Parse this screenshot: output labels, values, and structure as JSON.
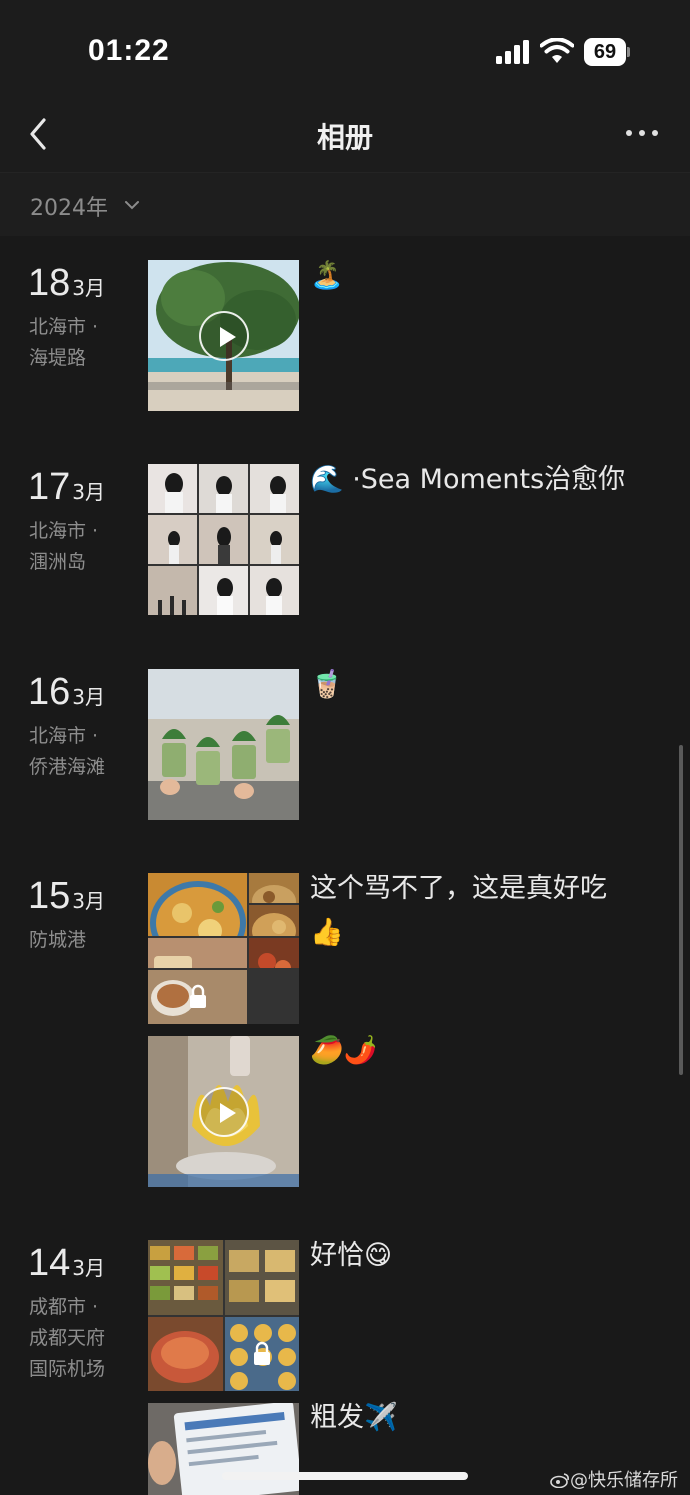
{
  "status_bar": {
    "time": "01:22",
    "battery": "69"
  },
  "nav": {
    "title": "相册"
  },
  "year_filter": {
    "label": "2024年"
  },
  "entries": [
    {
      "day": "18",
      "month": "3月",
      "location": [
        "北海市 ·",
        "海堤路"
      ],
      "caption": "🏝️"
    },
    {
      "day": "17",
      "month": "3月",
      "location": [
        "北海市 ·",
        "涠洲岛"
      ],
      "caption": "🌊 ·Sea Moments治愈你"
    },
    {
      "day": "16",
      "month": "3月",
      "location": [
        "北海市 ·",
        "侨港海滩"
      ],
      "caption": "🧋"
    },
    {
      "day": "15",
      "month": "3月",
      "location": [
        "防城港"
      ],
      "caption": "这个骂不了，这是真好吃👍",
      "caption2": "🥭🌶️"
    },
    {
      "day": "14",
      "month": "3月",
      "location": [
        "成都市 ·",
        "成都天府",
        "国际机场"
      ],
      "caption": "好恰😋",
      "caption2": "粗发✈️"
    }
  ],
  "watermark": "@快乐储存所",
  "colors": {
    "background": "#191919",
    "header": "#1c1c1c",
    "secondary_text": "#8d8d8d"
  }
}
